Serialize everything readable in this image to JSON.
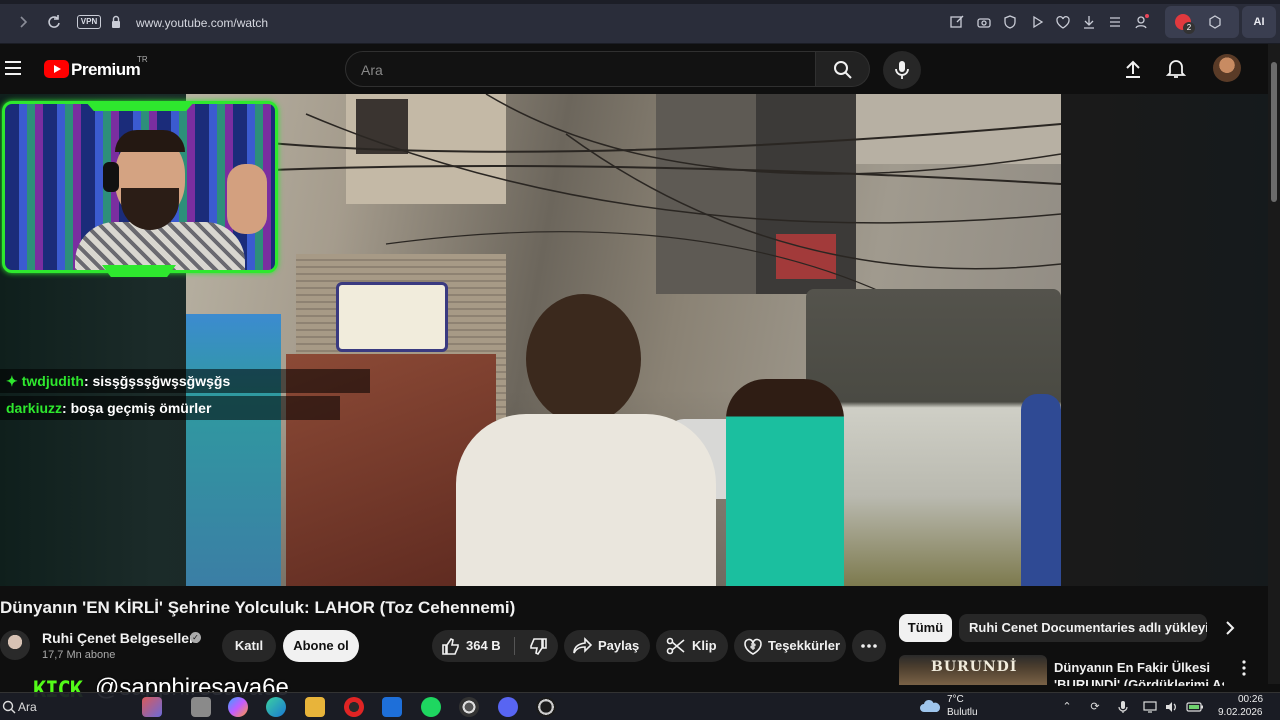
{
  "browser": {
    "vpn_label": "VPN",
    "url": "www.youtube.com/watch",
    "ai_label": "AI",
    "notification_count": "2"
  },
  "header": {
    "logo_text": "Premium",
    "country_code": "TR",
    "search_placeholder": "Ara"
  },
  "chat": {
    "messages": [
      {
        "user": "twdjudith",
        "text": ": sisşğşsşğwşsğwşğs",
        "badge": "✦"
      },
      {
        "user": "darkiuzz",
        "text": ": boşa geçmiş ömürler"
      }
    ]
  },
  "video": {
    "title": "Dünyanın 'EN KİRLİ' Şehrine Yolculuk: LAHOR (Toz Cehennemi)",
    "channel_name": "Ruhi Çenet Belgeselleri",
    "subscribers": "17,7 Mn abone",
    "join_label": "Katıl",
    "subscribe_label": "Abone ol",
    "like_count": "364 B",
    "share_label": "Paylaş",
    "clip_label": "Klip",
    "thanks_label": "Teşekkürler"
  },
  "sidebar": {
    "chips": [
      "Tümü",
      "Ruhi Cenet Documentaries adlı yükleyiciden"
    ],
    "recommendation": {
      "thumb_text": "BURUNDİ",
      "title_line1": "Dünyanın En Fakir Ülkesi",
      "title_line2": "'BURUNDİ' (Gördüklerimi Asla"
    }
  },
  "overlay": {
    "kick_logo": "KICK",
    "kick_user": "@sapphiresava6e"
  },
  "taskbar": {
    "search_label": "Ara",
    "temperature": "7°C",
    "condition": "Bulutlu",
    "time": "00:26",
    "date": "9.02.2026"
  },
  "colors": {
    "kick_green": "#53fc18",
    "webcam_border": "#2ee82e",
    "youtube_red": "#ff0000"
  }
}
